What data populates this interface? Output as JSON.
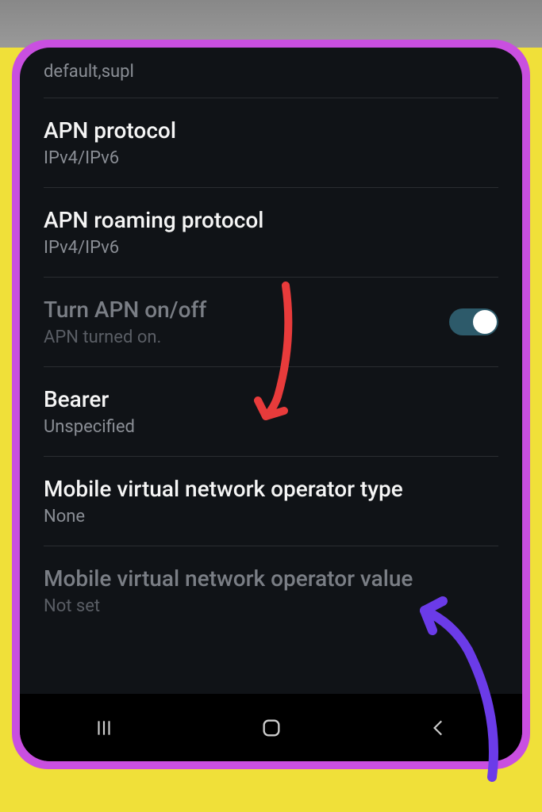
{
  "settings": {
    "apn_type_value": "default,supl",
    "apn_protocol": {
      "title": "APN protocol",
      "value": "IPv4/IPv6"
    },
    "apn_roaming": {
      "title": "APN roaming protocol",
      "value": "IPv4/IPv6"
    },
    "apn_toggle": {
      "title": "Turn APN on/off",
      "value": "APN turned on.",
      "enabled": true
    },
    "bearer": {
      "title": "Bearer",
      "value": "Unspecified"
    },
    "mvno_type": {
      "title": "Mobile virtual network operator type",
      "value": "None"
    },
    "mvno_value": {
      "title": "Mobile virtual network operator value",
      "value": "Not set"
    }
  },
  "annotation_colors": {
    "red": "#e83b3b",
    "purple": "#6b3be8"
  }
}
